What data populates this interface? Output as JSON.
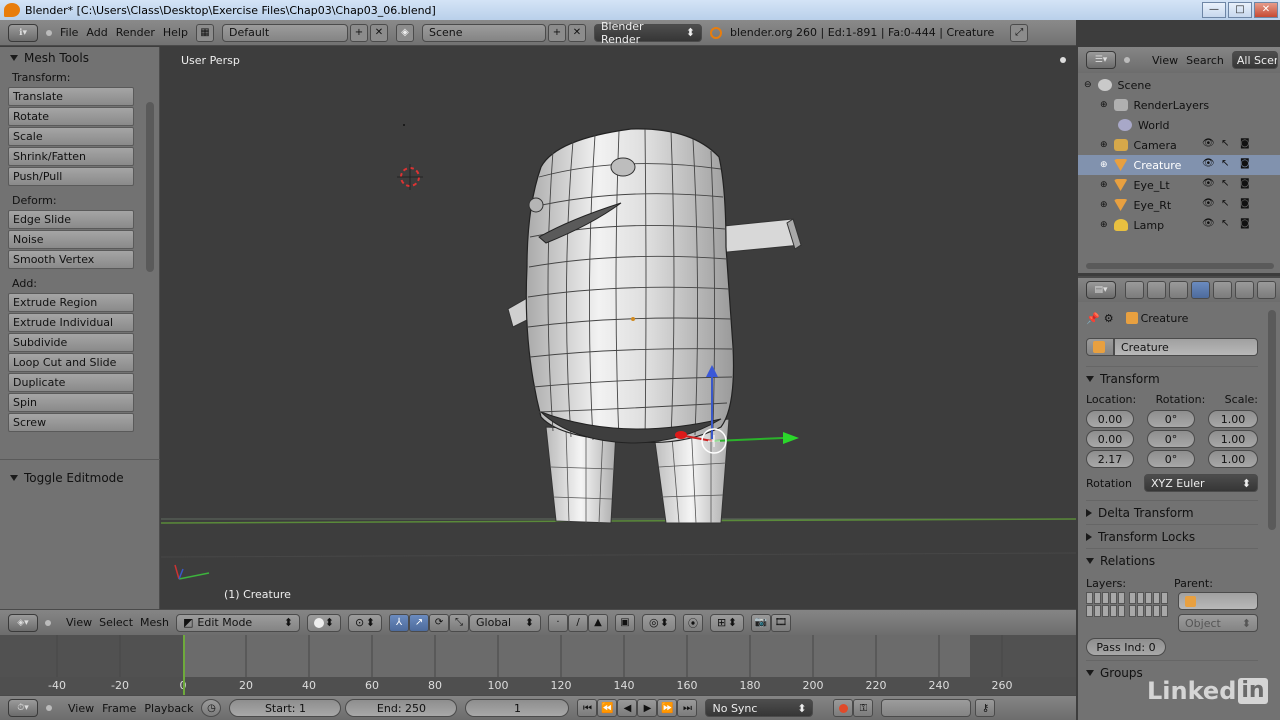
{
  "window": {
    "title": "Blender* [C:\\Users\\Class\\Desktop\\Exercise Files\\Chap03\\Chap03_06.blend]",
    "btn_min": "—",
    "btn_max": "□",
    "btn_close": "✕"
  },
  "info_header": {
    "menus": [
      "File",
      "Add",
      "Render",
      "Help"
    ],
    "layout": "Default",
    "scene": "Scene",
    "engine": "Blender Render",
    "stats": "blender.org 260 | Ed:1-891 | Fa:0-444 | Creature"
  },
  "toolshelf": {
    "title": "Mesh Tools",
    "groups": [
      {
        "label": "Transform:",
        "buttons": [
          "Translate",
          "Rotate",
          "Scale",
          "Shrink/Fatten",
          "Push/Pull"
        ]
      },
      {
        "label": "Deform:",
        "buttons": [
          "Edge Slide",
          "Noise",
          "Smooth Vertex"
        ]
      },
      {
        "label": "Add:",
        "buttons": [
          "Extrude Region",
          "Extrude Individual",
          "Subdivide",
          "Loop Cut and Slide",
          "Duplicate",
          "Spin",
          "Screw"
        ]
      }
    ],
    "toggle_panel": "Toggle Editmode"
  },
  "viewport": {
    "view_name": "User Persp",
    "object_label": "(1) Creature"
  },
  "view3d_header": {
    "menus": [
      "View",
      "Select",
      "Mesh"
    ],
    "mode": "Edit Mode",
    "orientation": "Global"
  },
  "timeline": {
    "ticks": [
      -40,
      -20,
      0,
      20,
      40,
      60,
      80,
      100,
      120,
      140,
      160,
      180,
      200,
      220,
      240,
      260
    ],
    "current_frame": 1
  },
  "timeline_header": {
    "menus": [
      "View",
      "Frame",
      "Playback"
    ],
    "start": "Start: 1",
    "end": "End: 250",
    "frame": "1",
    "sync": "No Sync"
  },
  "outliner": {
    "menus": [
      "View",
      "Search"
    ],
    "filter": "All Scen",
    "items": [
      {
        "label": "Scene",
        "indent": 0,
        "selected": false,
        "color": "#c9c9c9",
        "controls": false
      },
      {
        "label": "RenderLayers",
        "indent": 1,
        "selected": false,
        "color": "#b0b0b0",
        "controls": false
      },
      {
        "label": "World",
        "indent": 1,
        "selected": false,
        "color": "#a8a8c8",
        "controls": false
      },
      {
        "label": "Camera",
        "indent": 1,
        "selected": false,
        "color": "#d6a84a",
        "controls": true
      },
      {
        "label": "Creature",
        "indent": 1,
        "selected": true,
        "color": "#e8a040",
        "controls": true
      },
      {
        "label": "Eye_Lt",
        "indent": 1,
        "selected": false,
        "color": "#e8a040",
        "controls": true
      },
      {
        "label": "Eye_Rt",
        "indent": 1,
        "selected": false,
        "color": "#e8a040",
        "controls": true
      },
      {
        "label": "Lamp",
        "indent": 1,
        "selected": false,
        "color": "#e8c040",
        "controls": true
      }
    ]
  },
  "properties": {
    "breadcrumb": "Creature",
    "object_name": "Creature",
    "transform": {
      "title": "Transform",
      "location_label": "Location:",
      "rotation_label": "Rotation:",
      "scale_label": "Scale:",
      "location": [
        "0.00",
        "0.00",
        "2.17"
      ],
      "rotation": [
        "0°",
        "0°",
        "0°"
      ],
      "scale": [
        "1.00",
        "1.00",
        "1.00"
      ],
      "rotation_mode_label": "Rotation",
      "rotation_mode": "XYZ Euler"
    },
    "panels": [
      "Delta Transform",
      "Transform Locks"
    ],
    "relations": {
      "title": "Relations",
      "layers_label": "Layers:",
      "parent_label": "Parent:",
      "parent_type": "Object",
      "pass_index": "Pass Ind: 0"
    },
    "groups": "Groups"
  },
  "watermark": {
    "text": "Linked",
    "badge": "in"
  }
}
